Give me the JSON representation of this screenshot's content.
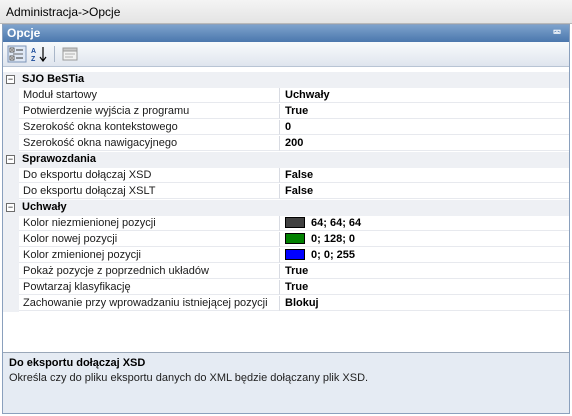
{
  "window": {
    "title": "Administracja->Opcje"
  },
  "panel": {
    "title": "Opcje",
    "collapse_icon": "double-chevron-up-icon"
  },
  "toolbar": {
    "buttons": [
      {
        "icon": "categorized-view-icon"
      },
      {
        "icon": "alphabetical-sort-icon"
      },
      {
        "icon": "property-pages-icon"
      }
    ]
  },
  "grid": {
    "categories": [
      {
        "label": "SJO BeSTia",
        "expanded": true,
        "props": [
          {
            "name": "Moduł startowy",
            "value": "Uchwały"
          },
          {
            "name": "Potwierdzenie wyjścia z programu",
            "value": "True"
          },
          {
            "name": "Szerokość okna kontekstowego",
            "value": "0"
          },
          {
            "name": "Szerokość okna nawigacyjnego",
            "value": "200"
          }
        ]
      },
      {
        "label": "Sprawozdania",
        "expanded": true,
        "props": [
          {
            "name": "Do eksportu dołączaj XSD",
            "value": "False"
          },
          {
            "name": "Do eksportu dołączaj XSLT",
            "value": "False"
          }
        ]
      },
      {
        "label": "Uchwały",
        "expanded": true,
        "props": [
          {
            "name": "Kolor niezmienionej pozycji",
            "value": "64; 64; 64",
            "color": "#404040"
          },
          {
            "name": "Kolor nowej pozycji",
            "value": "0; 128; 0",
            "color": "#008000"
          },
          {
            "name": "Kolor zmienionej pozycji",
            "value": "0; 0; 255",
            "color": "#0000ff"
          },
          {
            "name": "Pokaż pozycje z poprzednich układów",
            "value": "True"
          },
          {
            "name": "Powtarzaj klasyfikację",
            "value": "True"
          },
          {
            "name": "Zachowanie przy wprowadzaniu istniejącej pozycji",
            "value": "Blokuj"
          }
        ]
      }
    ]
  },
  "description": {
    "title": "Do eksportu dołączaj XSD",
    "text": "Określa czy do pliku eksportu danych do XML będzie dołączany plik XSD."
  },
  "colors": {
    "header_top": "#7da2cc",
    "header_bottom": "#4b77ad",
    "category_bg": "#eef0f4",
    "description_bg": "#e5ebf3"
  }
}
